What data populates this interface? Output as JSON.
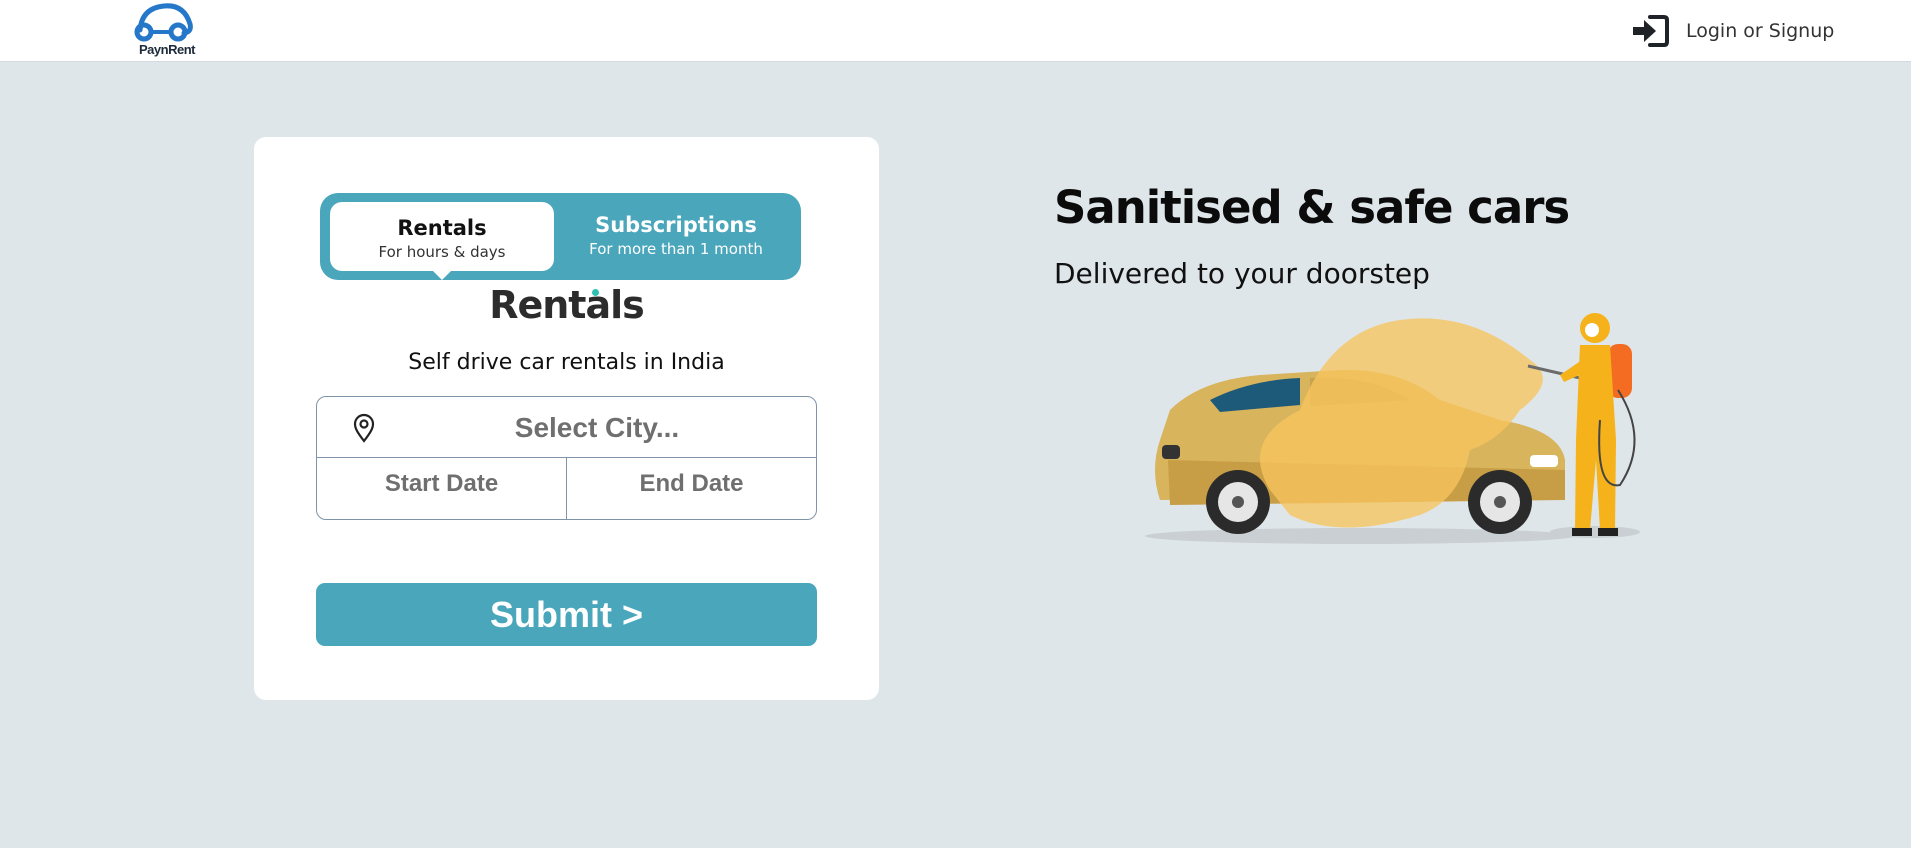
{
  "header": {
    "logo_text": "PaynRent",
    "login_label": "Login or Signup"
  },
  "booking": {
    "tabs": [
      {
        "title": "Rentals",
        "subtitle": "For hours & days",
        "active": true
      },
      {
        "title": "Subscriptions",
        "subtitle": "For more than 1 month",
        "active": false
      }
    ],
    "brand": "Rentals",
    "tagline": "Self drive car rentals in India",
    "city_placeholder": "Select City...",
    "start_date_placeholder": "Start Date",
    "end_date_placeholder": "End Date",
    "submit_label": "Submit >"
  },
  "hero": {
    "title": "Sanitised & safe cars",
    "subtitle": "Delivered to your doorstep"
  },
  "colors": {
    "accent": "#4aa6bb",
    "background": "#dfe6ea",
    "brand_teal": "#2fbfb3",
    "car_yellow": "#e8b44a",
    "suit_orange": "#f4a316"
  },
  "icons": {
    "login": "login-arrow-icon",
    "location": "map-pin-icon"
  }
}
